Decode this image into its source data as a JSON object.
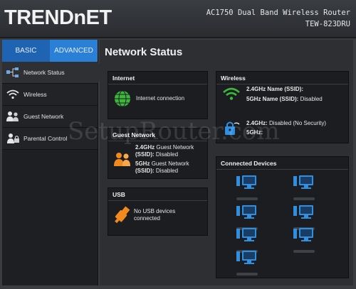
{
  "brand": {
    "logo": "TRENDnET",
    "product": "AC1750 Dual Band Wireless Router",
    "model": "TEW-823DRU"
  },
  "tabs": [
    {
      "label": "BASIC"
    },
    {
      "label": "ADVANCED"
    }
  ],
  "nav": [
    {
      "label": "Network Status"
    },
    {
      "label": "Wireless"
    },
    {
      "label": "Guest Network"
    },
    {
      "label": "Parental Control"
    }
  ],
  "main": {
    "title": "Network Status"
  },
  "internet": {
    "title": "Internet",
    "status": "Internet connection"
  },
  "guest": {
    "title": "Guest Network",
    "g24_label": "2.4GHz",
    "g24_text": "Guest Network",
    "g24_ssid_label": "(SSID):",
    "g24_ssid_value": "Disabled",
    "g5_label": "5GHz",
    "g5_text": "Guest Network",
    "g5_ssid_label": "(SSID):",
    "g5_ssid_value": "Disabled"
  },
  "usb": {
    "title": "USB",
    "line1": "No USB devices",
    "line2": "connected"
  },
  "wireless": {
    "title": "Wireless",
    "name24_label": "2.4GHz Name (SSID):",
    "name5_label": "5GHz Name (SSID):",
    "name5_value": "Disabled",
    "sec24_label": "2.4GHz:",
    "sec24_value": "Disabled (No Security)",
    "sec5_label": "5GHz:"
  },
  "devices": {
    "title": "Connected Devices"
  },
  "watermark": "SetupRouter.com",
  "colors": {
    "brand_blue": "#1f63b3",
    "tab_blue": "#2a7fd6",
    "icon_green": "#3db83d",
    "icon_orange": "#f08a1e",
    "device_blue": "#2f8fe0"
  }
}
